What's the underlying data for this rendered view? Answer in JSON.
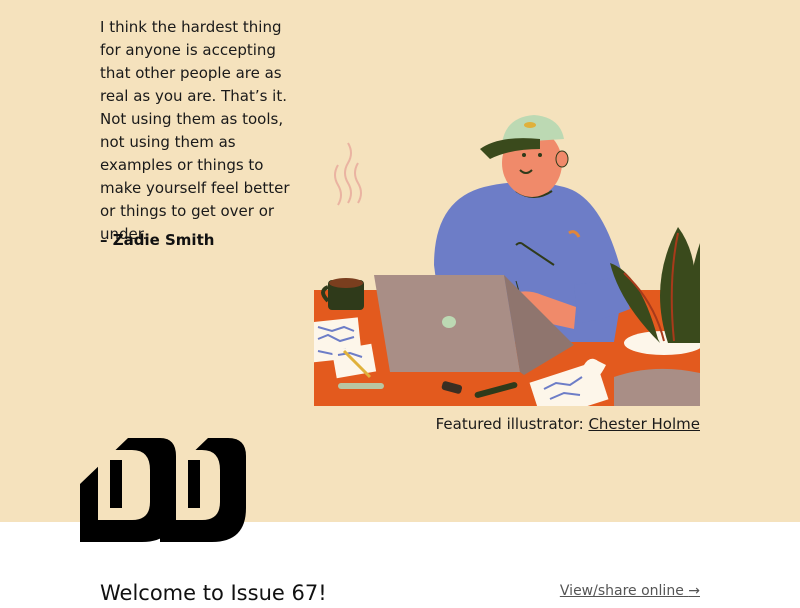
{
  "quote": {
    "text": "I think the hardest thing for anyone is accepting that other people are as real as you are. That’s it. Not using them as tools, not using them as examples or things to make yourself feel better or things to get over or under.",
    "author": "– Zadie Smith"
  },
  "caption": {
    "label": "Featured illustrator: ",
    "illustrator_name": "Chester Holme"
  },
  "issue": {
    "title": "Welcome to Issue 67!",
    "share_label": "View/share online",
    "share_arrow": "→"
  },
  "colors": {
    "hero_background": "#f5e2bd",
    "desk": "#e35a1e",
    "sweater": "#6d7dc7",
    "laptop": "#a98e86",
    "plant": "#3a4a1c"
  },
  "icons": {
    "logo": "dd-logo",
    "share_arrow": "right-arrow-icon"
  }
}
